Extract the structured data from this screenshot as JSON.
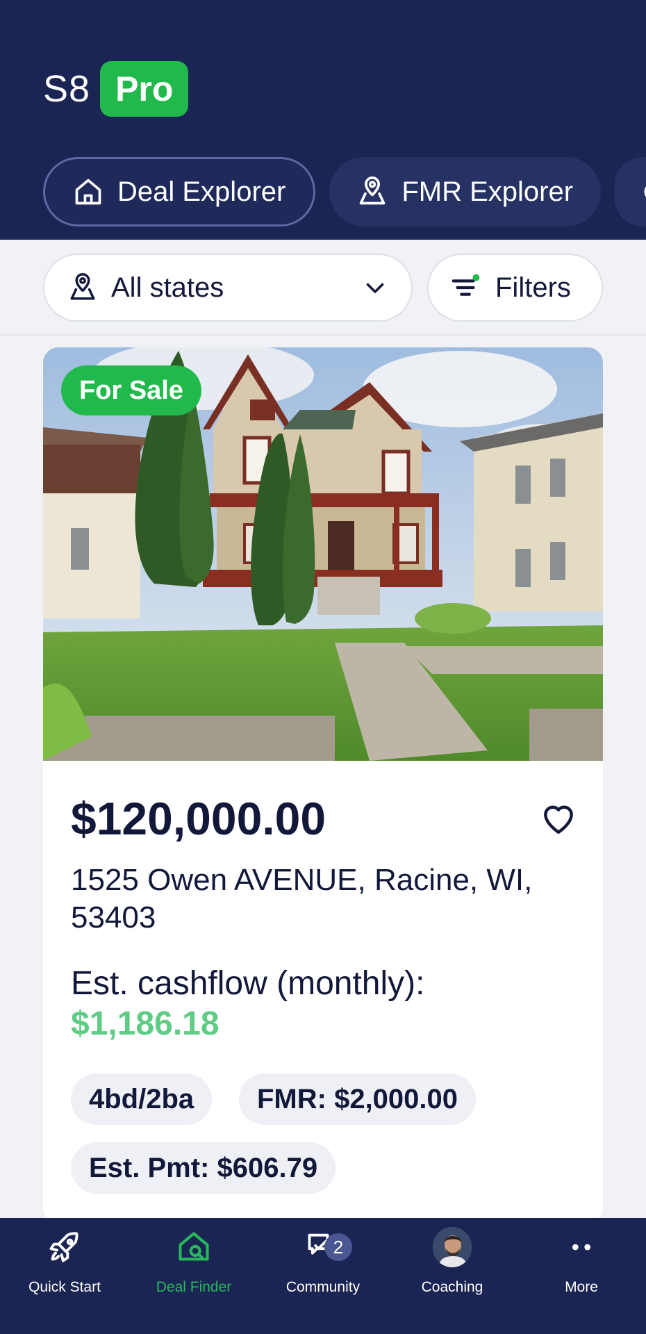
{
  "header": {
    "logo_text": "S8",
    "logo_badge": "Pro",
    "tabs": [
      {
        "label": "Deal Explorer",
        "icon": "home-icon",
        "active": true
      },
      {
        "label": "FMR Explorer",
        "icon": "map-pin-icon",
        "active": false
      }
    ]
  },
  "filters": {
    "state_value": "All states",
    "filters_label": "Filters"
  },
  "listing": {
    "status_badge": "For Sale",
    "price": "$120,000.00",
    "address": "1525 Owen AVENUE, Racine, WI, 53403",
    "cashflow_label": "Est. cashflow (monthly):",
    "cashflow_value": "$1,186.18",
    "beds_baths": "4bd/2ba",
    "fmr": "FMR: $2,000.00",
    "est_payment": "Est. Pmt: $606.79"
  },
  "bottom_nav": {
    "items": [
      {
        "label": "Quick Start",
        "icon": "rocket-icon"
      },
      {
        "label": "Deal Finder",
        "icon": "home-search-icon",
        "active": true
      },
      {
        "label": "Community",
        "icon": "chat-icon",
        "badge": "2"
      },
      {
        "label": "Coaching",
        "icon": "avatar"
      },
      {
        "label": "More",
        "icon": "more-dots-icon"
      }
    ]
  },
  "colors": {
    "navy": "#1b2553",
    "green": "#22b94c",
    "cashflow_green": "#5fcb84"
  }
}
